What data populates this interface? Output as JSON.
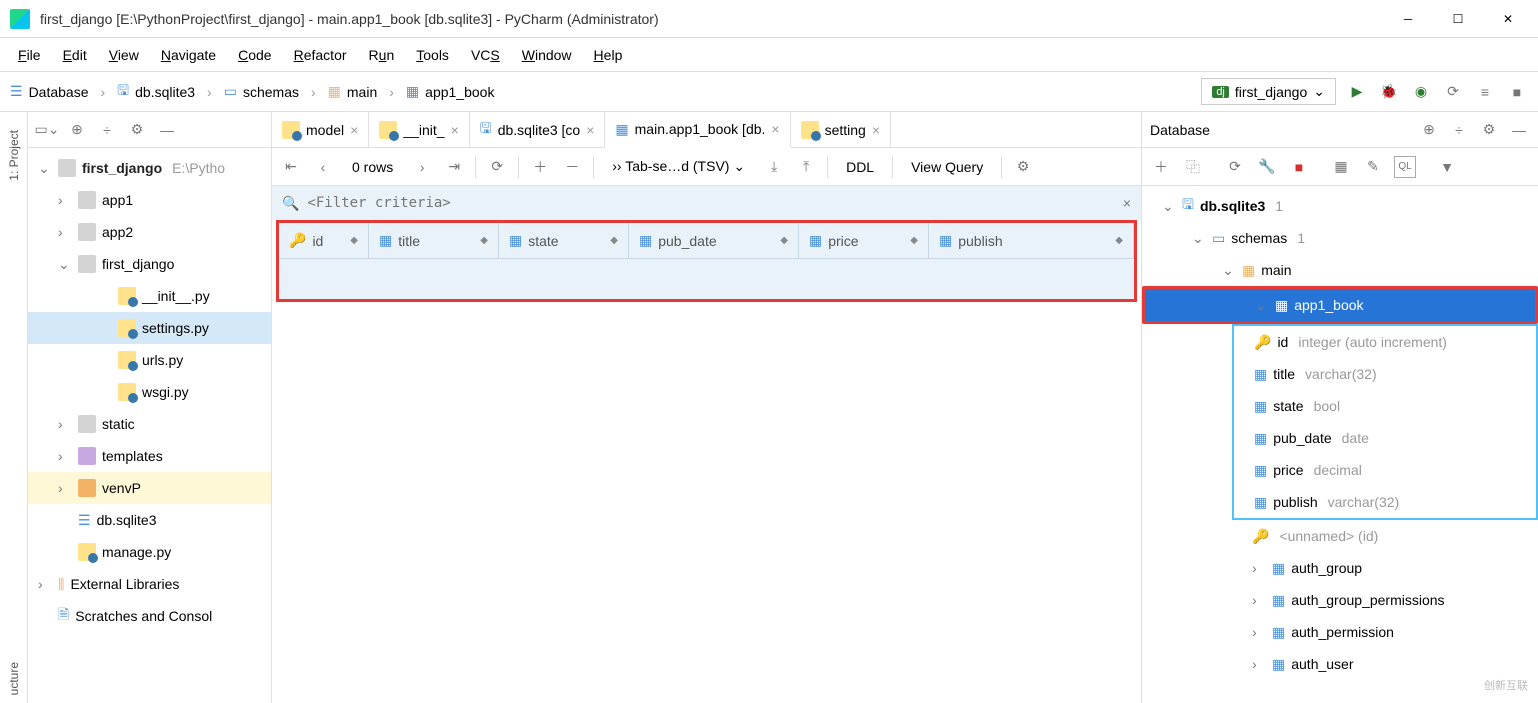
{
  "window": {
    "title": "first_django [E:\\PythonProject\\first_django] - main.app1_book [db.sqlite3] - PyCharm (Administrator)"
  },
  "menu": [
    "File",
    "Edit",
    "View",
    "Navigate",
    "Code",
    "Refactor",
    "Run",
    "Tools",
    "VCS",
    "Window",
    "Help"
  ],
  "breadcrumbs": [
    "Database",
    "db.sqlite3",
    "schemas",
    "main",
    "app1_book"
  ],
  "run_config": "first_django",
  "side_tabs": {
    "project": "1: Project",
    "structure": "ucture"
  },
  "project_tree": {
    "root": {
      "name": "first_django",
      "path": "E:\\Pytho"
    },
    "items": [
      {
        "indent": 1,
        "chev": "›",
        "icon": "folder",
        "name": "app1"
      },
      {
        "indent": 1,
        "chev": "›",
        "icon": "folder",
        "name": "app2"
      },
      {
        "indent": 1,
        "chev": "⌄",
        "icon": "folder",
        "name": "first_django"
      },
      {
        "indent": 3,
        "icon": "py",
        "name": "__init__.py"
      },
      {
        "indent": 3,
        "icon": "py",
        "name": "settings.py",
        "sel": true
      },
      {
        "indent": 3,
        "icon": "py",
        "name": "urls.py"
      },
      {
        "indent": 3,
        "icon": "py",
        "name": "wsgi.py"
      },
      {
        "indent": 1,
        "chev": "›",
        "icon": "folder",
        "name": "static"
      },
      {
        "indent": 1,
        "chev": "›",
        "icon": "folder-purple",
        "name": "templates"
      },
      {
        "indent": 1,
        "chev": "›",
        "icon": "folder-orange",
        "name": "venvP",
        "hl": true
      },
      {
        "indent": 1,
        "icon": "db",
        "name": "db.sqlite3"
      },
      {
        "indent": 1,
        "icon": "py",
        "name": "manage.py"
      }
    ],
    "ext_lib": "External Libraries",
    "scratches": "Scratches and Consol"
  },
  "tabs": [
    {
      "label": "model",
      "icon": "py"
    },
    {
      "label": "__init_",
      "icon": "py"
    },
    {
      "label": "db.sqlite3 [co",
      "icon": "db"
    },
    {
      "label": "main.app1_book [db.",
      "icon": "table",
      "active": true
    },
    {
      "label": "setting",
      "icon": "py"
    }
  ],
  "db_toolbar": {
    "rows_label": "0 rows",
    "format": "Tab-se…d (TSV)",
    "ddl": "DDL",
    "view_query": "View Query"
  },
  "filter_placeholder": "<Filter criteria>",
  "columns": [
    "id",
    "title",
    "state",
    "pub_date",
    "price",
    "publish"
  ],
  "database_panel": {
    "title": "Database",
    "root": {
      "name": "db.sqlite3",
      "suffix": "1"
    },
    "schemas": {
      "name": "schemas",
      "suffix": "1"
    },
    "main": "main",
    "selected_table": "app1_book",
    "cols": [
      {
        "name": "id",
        "type": "integer (auto increment)",
        "key": true
      },
      {
        "name": "title",
        "type": "varchar(32)"
      },
      {
        "name": "state",
        "type": "bool"
      },
      {
        "name": "pub_date",
        "type": "date"
      },
      {
        "name": "price",
        "type": "decimal"
      },
      {
        "name": "publish",
        "type": "varchar(32)"
      }
    ],
    "unnamed": "<unnamed> (id)",
    "other_tables": [
      "auth_group",
      "auth_group_permissions",
      "auth_permission",
      "auth_user"
    ]
  },
  "watermark": "创新互联"
}
